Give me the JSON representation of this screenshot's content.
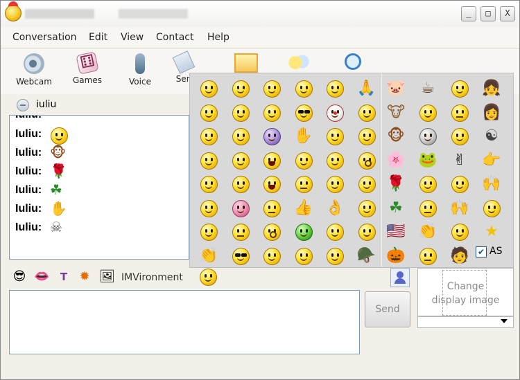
{
  "menu": [
    "Conversation",
    "Edit",
    "View",
    "Contact",
    "Help"
  ],
  "toolbar": {
    "webcam": "Webcam",
    "games": "Games",
    "voice": "Voice",
    "send": "Sen"
  },
  "window_buttons": {
    "min": "_",
    "max": "□",
    "close": "X"
  },
  "contact": {
    "name": "iuliu"
  },
  "history": {
    "speaker": "Iuliu:",
    "lines": [
      {
        "emote": "smiley-blush-icon"
      },
      {
        "emote": "monkey-icon",
        "glyph": "🐵"
      },
      {
        "emote": "rose-icon",
        "glyph": "🌹"
      },
      {
        "emote": "clover-icon",
        "glyph": "☘"
      },
      {
        "emote": "high-five-icon",
        "glyph": "✋"
      },
      {
        "emote": "skull-icon",
        "glyph": "☠"
      }
    ]
  },
  "format_bar": {
    "imvironment": "IMVironment"
  },
  "send_button": "Send",
  "display_image": {
    "line1": "Change",
    "line2": "display image"
  },
  "emoticons": {
    "autoscroll_label": "AS",
    "autoscroll_check": "✔",
    "left_grid": [
      [
        "smile",
        "kiss",
        "grin",
        "wink",
        "thinking",
        "pray"
      ],
      [
        "laugh",
        "tongue",
        "whistle",
        "nerd",
        "clown",
        "cry"
      ],
      [
        "blush",
        "smirk",
        "devil",
        "hand",
        "angel",
        "sleepy"
      ],
      [
        "bigmouth",
        "wink2",
        "shout",
        "sweat",
        "party",
        "surprised"
      ],
      [
        "shy",
        "yawn",
        "laugh2",
        "sad",
        "angry",
        "tongue2"
      ],
      [
        "smile2",
        "pink",
        "neutral",
        "thumbsup",
        "ok",
        "eyeroll"
      ],
      [
        "confused",
        "frown",
        "hush",
        "green",
        "dizzy",
        "confused2"
      ],
      [
        "clap",
        "glasses",
        "talk",
        "shh",
        "angel2",
        "viking"
      ]
    ],
    "right_grid": [
      [
        "pig",
        "cup",
        "smile",
        "girl"
      ],
      [
        "cow",
        "smile2",
        "frown",
        "woman"
      ],
      [
        "monkey",
        "skull",
        "think",
        "yinyang"
      ],
      [
        "flower",
        "frog",
        "peace",
        "point"
      ],
      [
        "rose",
        "think2",
        "eat",
        "hands"
      ],
      [
        "clover",
        "sad",
        "hands2",
        "laugh"
      ],
      [
        "flag",
        "clap",
        "rolleyes",
        "star"
      ],
      [
        "pumpkin",
        "grin2",
        "person",
        ""
      ]
    ],
    "glyph_map": {
      "pig": "🐷",
      "cup": "☕",
      "cow": "🐮",
      "monkey": "🐵",
      "flower": "🌸",
      "frog": "🐸",
      "rose": "🌹",
      "clover": "☘",
      "flag": "🇺🇸",
      "pumpkin": "🎃",
      "person": "🧑",
      "yinyang": "☯",
      "star": "★",
      "girl": "👧",
      "woman": "👩",
      "peace": "✌",
      "point": "👉",
      "hands": "🙌",
      "hands2": "🙌",
      "pray": "🙏",
      "hand": "✋",
      "thumbsup": "👍",
      "ok": "👌",
      "clap": "👏",
      "viking": "🪖"
    }
  }
}
